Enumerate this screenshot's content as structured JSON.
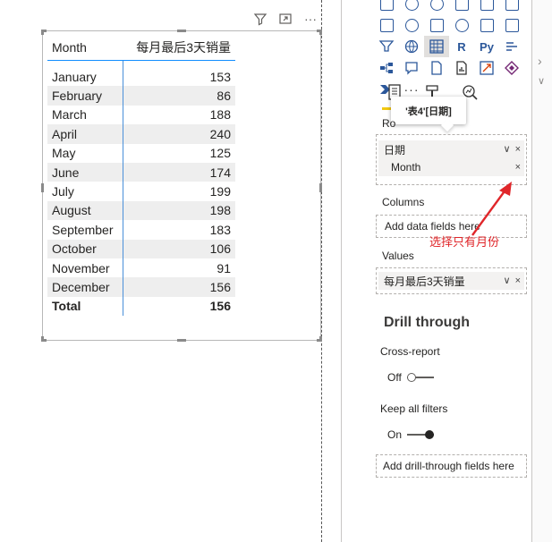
{
  "visual_header": {
    "icons": [
      "filter-icon",
      "focus-mode-icon",
      "more-options-icon"
    ],
    "more_label": "···"
  },
  "matrix": {
    "columns": {
      "row_header": "Month",
      "value_header": "每月最后3天销量"
    },
    "rows": [
      {
        "label": "January",
        "value": "153"
      },
      {
        "label": "February",
        "value": "86"
      },
      {
        "label": "March",
        "value": "188"
      },
      {
        "label": "April",
        "value": "240"
      },
      {
        "label": "May",
        "value": "125"
      },
      {
        "label": "June",
        "value": "174"
      },
      {
        "label": "July",
        "value": "199"
      },
      {
        "label": "August",
        "value": "198"
      },
      {
        "label": "September",
        "value": "183"
      },
      {
        "label": "October",
        "value": "106"
      },
      {
        "label": "November",
        "value": "91"
      },
      {
        "label": "December",
        "value": "156"
      }
    ],
    "total": {
      "label": "Total",
      "value": "156"
    }
  },
  "viz_pane": {
    "gallery_text": {
      "r_visual": "R",
      "py_visual": "Py",
      "more": "···"
    },
    "tooltip": "'表4'[日期]",
    "rows_label": "Ro",
    "rows_field_group": "日期",
    "rows_field_child": "Month",
    "columns_label": "Columns",
    "columns_placeholder": "Add data fields here",
    "values_label": "Values",
    "values_field": "每月最后3天销量",
    "drill_through_title": "Drill through",
    "cross_report_label": "Cross-report",
    "cross_report_state": "Off",
    "keep_filters_label": "Keep all filters",
    "keep_filters_state": "On",
    "drill_placeholder": "Add drill-through fields here",
    "icon_glyphs": {
      "dropdown": "∨",
      "remove": "×",
      "chevron_right": "›",
      "chevron_down": "∨"
    }
  },
  "annotation": {
    "text": "选择只有月份",
    "color": "#e0262a"
  },
  "colors": {
    "accent": "#118dff",
    "active_tab": "#f2c811",
    "annotation": "#e0262a"
  }
}
